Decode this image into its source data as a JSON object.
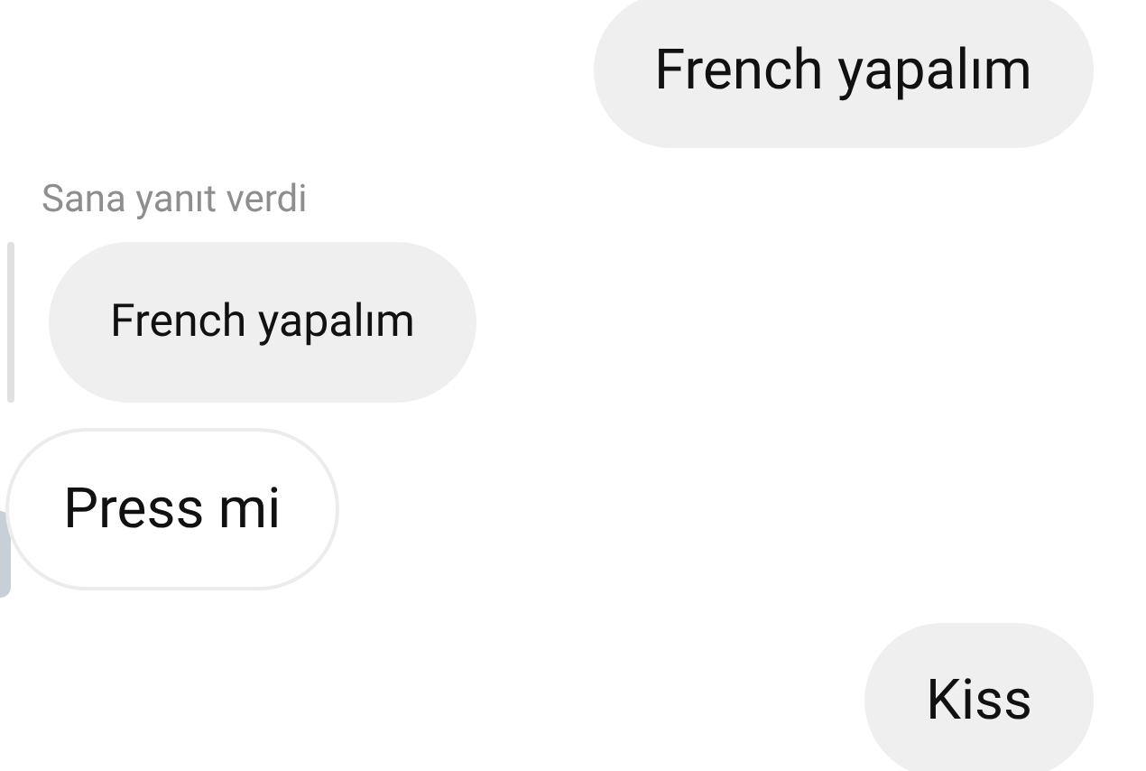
{
  "messages": [
    {
      "kind": "outgoing",
      "text": "French yapalım"
    },
    {
      "kind": "reply",
      "label": "Sana yanıt verdi",
      "quote": "French yapalım"
    },
    {
      "kind": "incoming",
      "text": "Press mi"
    },
    {
      "kind": "outgoing",
      "text": "Kiss"
    }
  ]
}
